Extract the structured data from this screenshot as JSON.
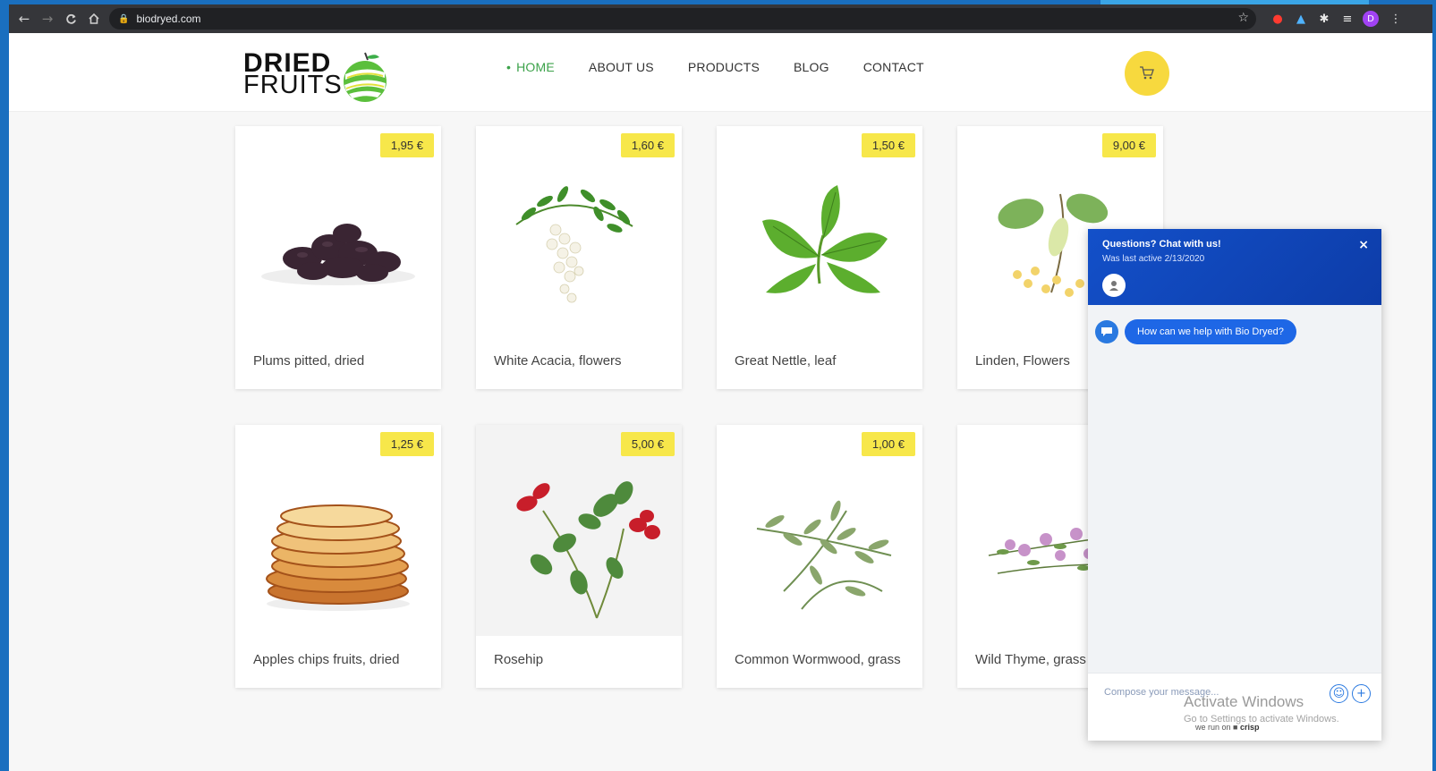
{
  "browser": {
    "url": "biodryed.com",
    "nav": {
      "back": "←",
      "forward": "→",
      "reload": "C",
      "home": "⌂"
    },
    "profile_initial": "D"
  },
  "header": {
    "logo_line1": "DRIED",
    "logo_line2": "FRUITS",
    "menu": [
      {
        "label": "HOME",
        "active": true
      },
      {
        "label": "ABOUT US",
        "active": false
      },
      {
        "label": "PRODUCTS",
        "active": false
      },
      {
        "label": "BLOG",
        "active": false
      },
      {
        "label": "CONTACT",
        "active": false
      }
    ]
  },
  "products": [
    {
      "name": "Plums pitted, dried",
      "price": "1,95 €",
      "image": "dried-plums"
    },
    {
      "name": "White Acacia, flowers",
      "price": "1,60 €",
      "image": "acacia-flowers"
    },
    {
      "name": "Great Nettle, leaf",
      "price": "1,50 €",
      "image": "nettle-leaf"
    },
    {
      "name": "Linden, Flowers",
      "price": "9,00 €",
      "image": "linden-flowers"
    },
    {
      "name": "Apples chips fruits, dried",
      "price": "1,25 €",
      "image": "apple-chips"
    },
    {
      "name": "Rosehip",
      "price": "5,00 €",
      "image": "rosehip"
    },
    {
      "name": "Common Wormwood, grass",
      "price": "1,00 €",
      "image": "wormwood"
    },
    {
      "name": "Wild Thyme, grass",
      "price": "",
      "image": "wild-thyme"
    }
  ],
  "chat": {
    "title": "Questions? Chat with us!",
    "subtitle": "Was last active 2/13/2020",
    "close": "×",
    "message": "How can we help with Bio Dryed?",
    "placeholder": "Compose your message...",
    "runon_prefix": "we run on",
    "runon_brand": "crisp"
  },
  "watermark": {
    "line1": "Activate Windows",
    "line2": "Go to Settings to activate Windows."
  },
  "colors": {
    "accent_green": "#3ca24a",
    "price_tag": "#f7e74a",
    "cart": "#f7d93e",
    "chat_blue": "#1350c9"
  }
}
